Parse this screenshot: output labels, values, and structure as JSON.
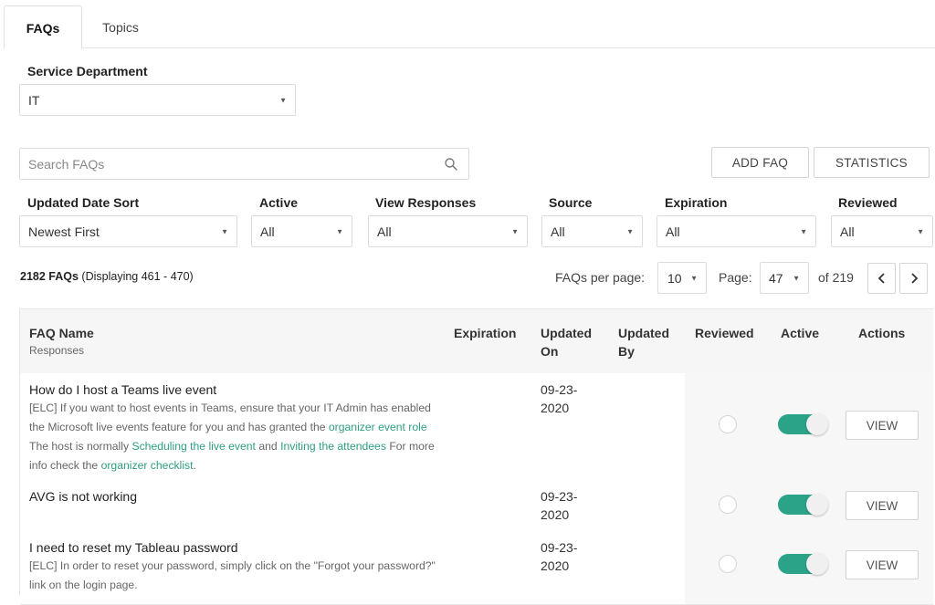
{
  "tabs": [
    {
      "label": "FAQs",
      "active": true
    },
    {
      "label": "Topics",
      "active": false
    }
  ],
  "service_department": {
    "label": "Service Department",
    "value": "IT"
  },
  "search": {
    "placeholder": "Search FAQs"
  },
  "buttons": {
    "add_faq": "ADD FAQ",
    "statistics": "STATISTICS"
  },
  "filters": [
    {
      "label": "Updated Date Sort",
      "value": "Newest First"
    },
    {
      "label": "Active",
      "value": "All"
    },
    {
      "label": "View Responses",
      "value": "All"
    },
    {
      "label": "Source",
      "value": "All"
    },
    {
      "label": "Expiration",
      "value": "All"
    },
    {
      "label": "Reviewed",
      "value": "All"
    }
  ],
  "summary": {
    "count": "2182 FAQs",
    "displaying": "(Displaying 461 - 470)"
  },
  "pagination": {
    "per_page_label": "FAQs per page:",
    "per_page": "10",
    "page_label": "Page:",
    "page": "47",
    "of_total": "of 219"
  },
  "table": {
    "headers": {
      "faq_name": "FAQ Name",
      "responses": "Responses",
      "expiration": "Expiration",
      "updated_on_1": "Updated",
      "updated_on_2": "On",
      "updated_by_1": "Updated",
      "updated_by_2": "By",
      "reviewed": "Reviewed",
      "active": "Active",
      "actions": "Actions"
    },
    "view_label": "VIEW",
    "rows": [
      {
        "name": "How do I host a Teams live event",
        "response_parts": [
          "[ELC] If you want to host events in Teams, ensure that your IT Admin has enabled the Microsoft live events feature for you and has granted the ",
          "organizer event role",
          " The host is normally ",
          "Scheduling the live event",
          " and ",
          "Inviting the attendees",
          " For more info check the ",
          "organizer checklist",
          "."
        ],
        "updated_1": "09-23-",
        "updated_2": "2020",
        "reviewed": false,
        "active": true
      },
      {
        "name": "AVG is not working",
        "response": "",
        "updated_1": "09-23-",
        "updated_2": "2020",
        "reviewed": false,
        "active": true
      },
      {
        "name": "I need to reset my Tableau password",
        "response": "[ELC] In order to reset your password, simply click on the \"Forgot your password?\" link on the login page.",
        "updated_1": "09-23-",
        "updated_2": "2020",
        "reviewed": false,
        "active": true
      }
    ]
  },
  "colors": {
    "accent": "#2aa389",
    "link": "#2f9d82"
  },
  "icons": {
    "search": "search-icon",
    "caret": "caret-down-icon",
    "prev": "chevron-left-icon",
    "next": "chevron-right-icon"
  }
}
